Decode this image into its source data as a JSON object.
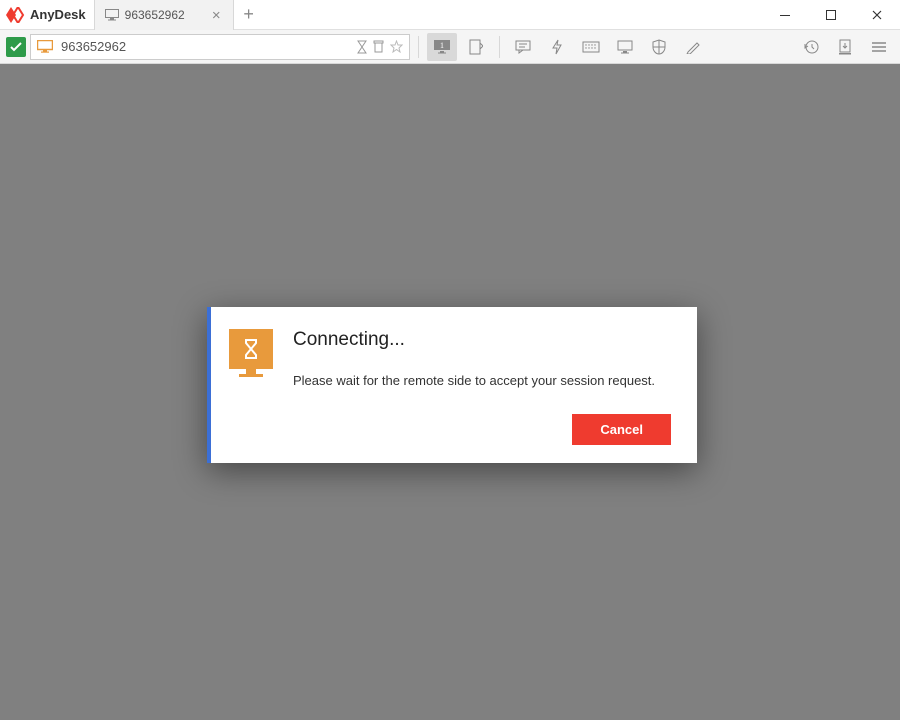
{
  "app": {
    "title": "AnyDesk"
  },
  "tabs": [
    {
      "label": "963652962"
    }
  ],
  "address": {
    "value": "963652962"
  },
  "toolbar": {
    "monitor_badge": "1"
  },
  "dialog": {
    "title": "Connecting...",
    "message": "Please wait for the remote side to accept your session request.",
    "cancel_label": "Cancel"
  },
  "icons": {
    "close": "×",
    "plus": "+"
  }
}
